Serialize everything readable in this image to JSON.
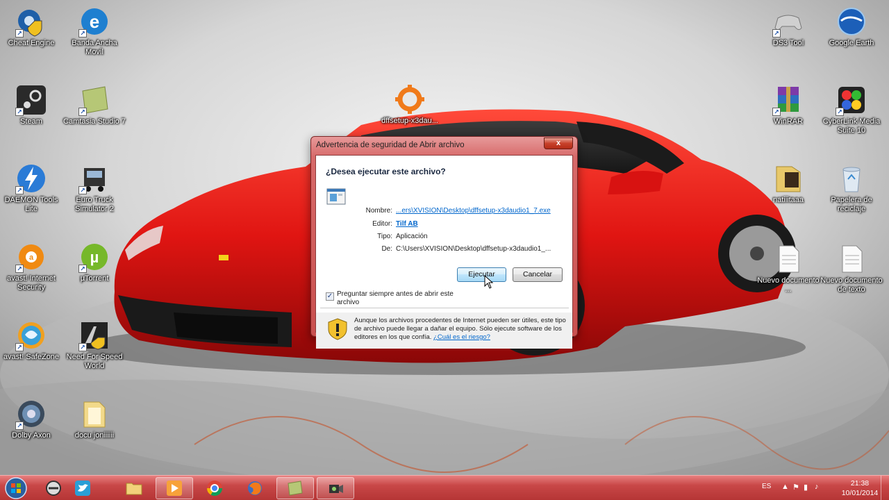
{
  "desktop": {
    "icons": [
      {
        "label": "Cheat Engine",
        "icon": "gear-shield-icon"
      },
      {
        "label": "Banda Ancha Movil",
        "icon": "globe-e-icon"
      },
      {
        "label": "Steam",
        "icon": "steam-icon"
      },
      {
        "label": "Camtasia Studio 7",
        "icon": "camtasia-icon"
      },
      {
        "label": "DAEMON Tools Lite",
        "icon": "lightning-icon"
      },
      {
        "label": "Euro Truck Simulator 2",
        "icon": "truck-icon"
      },
      {
        "label": "avast! Internet Security",
        "icon": "avast-icon"
      },
      {
        "label": "µTorrent",
        "icon": "utorrent-icon"
      },
      {
        "label": "avast! SafeZone",
        "icon": "safezone-icon"
      },
      {
        "label": "Need For Speed World",
        "icon": "nfs-icon"
      },
      {
        "label": "Dolby Axon",
        "icon": "dolby-icon"
      },
      {
        "label": "docu joniiiiii",
        "icon": "folder-icon"
      },
      {
        "label": "dffsetup-x3dau...",
        "icon": "orange-gear-icon"
      },
      {
        "label": "DS3 Tool",
        "icon": "gamepad-icon"
      },
      {
        "label": "Google Earth",
        "icon": "earth-icon"
      },
      {
        "label": "WinRAR",
        "icon": "winrar-icon"
      },
      {
        "label": "CyberLink Media Suite 10",
        "icon": "cyberlink-icon"
      },
      {
        "label": "natiiitaaa",
        "icon": "image-icon"
      },
      {
        "label": "Papelera de reciclaje",
        "icon": "recycle-bin-icon"
      },
      {
        "label": "Nuevo documento ...",
        "icon": "document-icon"
      },
      {
        "label": "Nuevo documento de texto",
        "icon": "document-icon"
      }
    ]
  },
  "dialog": {
    "title": "Advertencia de seguridad de Abrir archivo",
    "close_label": "x",
    "question": "¿Desea ejecutar este archivo?",
    "fields": {
      "name_key": "Nombre:",
      "name_val": "...ers\\XVISION\\Desktop\\dffsetup-x3daudio1_7.exe",
      "editor_key": "Editor:",
      "editor_val": "Tilf AB",
      "type_key": "Tipo:",
      "type_val": "Aplicación",
      "from_key": "De:",
      "from_val": "C:\\Users\\XVISION\\Desktop\\dffsetup-x3daudio1_..."
    },
    "run_label": "Ejecutar",
    "cancel_label": "Cancelar",
    "checkbox_label": "Preguntar siempre antes de abrir este archivo",
    "checkbox_checked": true,
    "warning_text": "Aunque los archivos procedentes de Internet pueden ser útiles, este tipo de archivo puede llegar a dañar el equipo. Sólo ejecute software de los editores en los que confía.",
    "warning_link": "¿Cuál es el riesgo?"
  },
  "taskbar": {
    "buttons": [
      "start-orb",
      "chrome-like-icon",
      "twitter-icon",
      "explorer-folder-icon",
      "media-player-icon",
      "chrome-icon",
      "firefox-icon",
      "camtasia-icon",
      "camera-icon"
    ],
    "tray": {
      "language": "ES",
      "time": "21:38",
      "date": "10/01/2014"
    }
  },
  "colors": {
    "taskbar": "#c84747",
    "dialog_frame": "#d76a6a",
    "link": "#0066cc"
  }
}
